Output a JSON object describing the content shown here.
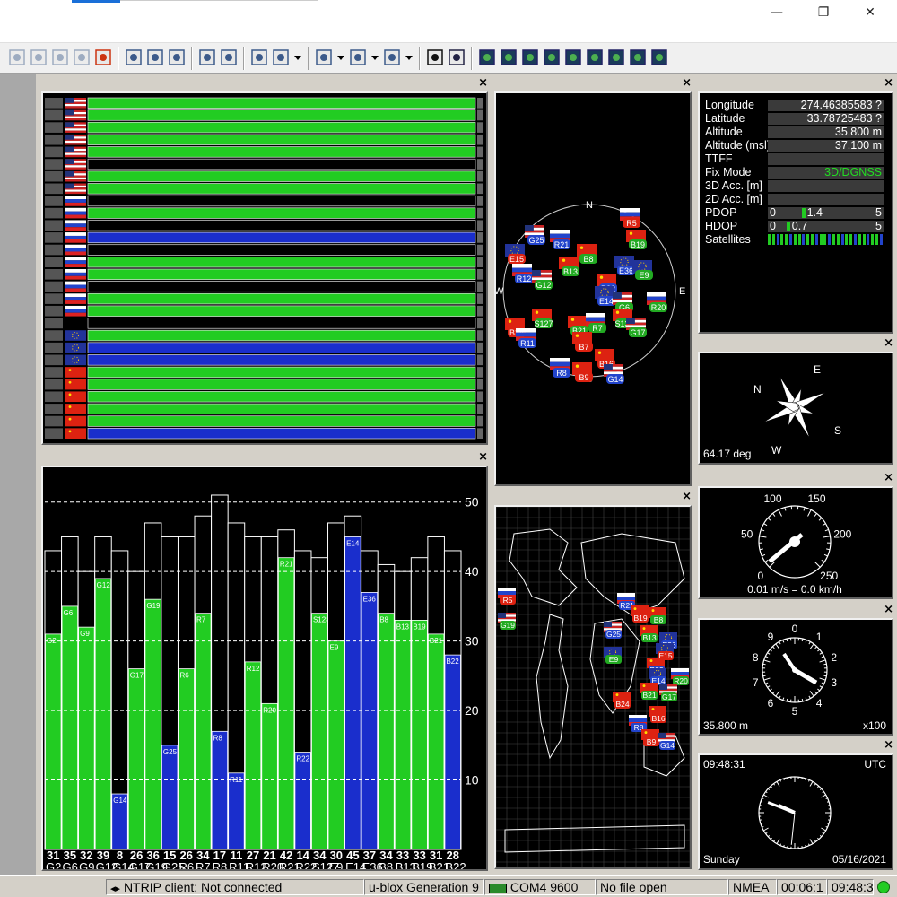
{
  "window": {
    "minimize": "—",
    "restore": "❐",
    "close": "✕",
    "accent": "#1a6fd8"
  },
  "toolbar": {
    "groups": [
      [
        "print-preview-icon",
        "cut-icon",
        "copy-icon",
        "paste-icon",
        "stop-icon"
      ],
      [
        "new-config-icon",
        "load-config-icon",
        "save-config-icon"
      ],
      [
        "view-split-icon",
        "view-panes-icon"
      ],
      [
        "statistics-icon",
        "table-view-icon",
        "dropdown-icon"
      ],
      [
        "chart-a-icon",
        "dropdown-icon",
        "chart-b-icon",
        "dropdown-icon",
        "chart-c-icon",
        "dropdown-icon"
      ],
      [
        "console-icon",
        "target-icon"
      ],
      [
        "sky-view-icon",
        "signal-icon",
        "bar-icon",
        "globe-icon",
        "list-icon",
        "compass-icon",
        "satellite-icon",
        "clock-icon",
        "tools-icon"
      ]
    ]
  },
  "navigation": {
    "rows": [
      {
        "label": "Longitude",
        "value": "274.46385583 ?"
      },
      {
        "label": "Latitude",
        "value": "33.78725483 ?"
      },
      {
        "label": "Altitude",
        "value": "35.800 m"
      },
      {
        "label": "Altitude (msl)",
        "value": "37.100 m"
      },
      {
        "label": "TTFF",
        "value": ""
      },
      {
        "label": "Fix Mode",
        "value": "3D/DGNSS"
      },
      {
        "label": "3D Acc. [m]",
        "value": ""
      },
      {
        "label": "2D Acc. [m]",
        "value": ""
      }
    ],
    "pdop": {
      "label": "PDOP",
      "min": "0",
      "value": "1.4",
      "max": "5",
      "fraction": 0.28
    },
    "hdop": {
      "label": "HDOP",
      "min": "0",
      "value": "0.7",
      "max": "5",
      "fraction": 0.14
    },
    "satellites_label": "Satellites",
    "fix_color": "#22dd22"
  },
  "compass": {
    "heading_text": "64.17 deg",
    "heading": 64.17,
    "n": "N",
    "e": "E",
    "s": "S",
    "w": "W"
  },
  "speedometer": {
    "ticks": [
      "0",
      "50",
      "100",
      "150",
      "200",
      "250"
    ],
    "readout": "0.01 m/s = 0.0 km/h"
  },
  "altimeter": {
    "ticks": [
      "0",
      "1",
      "2",
      "3",
      "4",
      "5",
      "6",
      "7",
      "8",
      "9"
    ],
    "readout": "35.800 m",
    "scale": "x100"
  },
  "clock": {
    "time": "09:48:31",
    "tz": "UTC",
    "day": "Sunday",
    "date": "05/16/2021"
  },
  "skyview": {
    "labels": {
      "n": "N",
      "e": "E",
      "s": "S",
      "w": "W"
    },
    "sats": [
      {
        "id": "G25",
        "flag": "us",
        "c": "#2244cc"
      },
      {
        "id": "R21",
        "flag": "ru",
        "c": "#2244cc"
      },
      {
        "id": "R5",
        "flag": "ru",
        "c": "#dd2211"
      },
      {
        "id": "B19",
        "flag": "cn",
        "c": "#22aa22"
      },
      {
        "id": "B8",
        "flag": "cn",
        "c": "#22aa22"
      },
      {
        "id": "B13",
        "flag": "cn",
        "c": "#22aa22"
      },
      {
        "id": "E36",
        "flag": "eu",
        "c": "#2244cc"
      },
      {
        "id": "E9",
        "flag": "eu",
        "c": "#22aa22"
      },
      {
        "id": "E15",
        "flag": "eu",
        "c": "#dd2211"
      },
      {
        "id": "R12",
        "flag": "ru",
        "c": "#2244cc"
      },
      {
        "id": "G12",
        "flag": "us",
        "c": "#22aa22"
      },
      {
        "id": "B22",
        "flag": "cn",
        "c": "#2244cc"
      },
      {
        "id": "E14",
        "flag": "eu",
        "c": "#2244cc"
      },
      {
        "id": "R20",
        "flag": "ru",
        "c": "#22aa22"
      },
      {
        "id": "G6",
        "flag": "us",
        "c": "#22aa22"
      },
      {
        "id": "S127",
        "flag": "cn",
        "c": "#22aa22"
      },
      {
        "id": "B21",
        "flag": "cn",
        "c": "#22aa22"
      },
      {
        "id": "R7",
        "flag": "ru",
        "c": "#22aa22"
      },
      {
        "id": "S137",
        "flag": "cn",
        "c": "#22aa22"
      },
      {
        "id": "G17",
        "flag": "us",
        "c": "#22aa22"
      },
      {
        "id": "B24",
        "flag": "cn",
        "c": "#dd2211"
      },
      {
        "id": "R11",
        "flag": "ru",
        "c": "#2244cc"
      },
      {
        "id": "B7",
        "flag": "cn",
        "c": "#dd2211"
      },
      {
        "id": "B16",
        "flag": "cn",
        "c": "#dd2211"
      },
      {
        "id": "R8",
        "flag": "ru",
        "c": "#2244cc"
      },
      {
        "id": "B9",
        "flag": "cn",
        "c": "#dd2211"
      },
      {
        "id": "G14",
        "flag": "us",
        "c": "#2244cc"
      }
    ]
  },
  "worldmap": {
    "sats": [
      {
        "id": "R5",
        "flag": "ru",
        "c": "#dd2211"
      },
      {
        "id": "G19",
        "flag": "us",
        "c": "#22aa22"
      },
      {
        "id": "R21",
        "flag": "ru",
        "c": "#2244cc"
      },
      {
        "id": "B19",
        "flag": "cn",
        "c": "#dd2211"
      },
      {
        "id": "B8",
        "flag": "cn",
        "c": "#22aa22"
      },
      {
        "id": "G25",
        "flag": "us",
        "c": "#2244cc"
      },
      {
        "id": "B13",
        "flag": "cn",
        "c": "#22aa22"
      },
      {
        "id": "E36",
        "flag": "eu",
        "c": "#2244cc"
      },
      {
        "id": "E9",
        "flag": "eu",
        "c": "#22aa22"
      },
      {
        "id": "E15",
        "flag": "eu",
        "c": "#dd2211"
      },
      {
        "id": "B22",
        "flag": "cn",
        "c": "#2244cc"
      },
      {
        "id": "E14",
        "flag": "eu",
        "c": "#2244cc"
      },
      {
        "id": "R20",
        "flag": "ru",
        "c": "#22aa22"
      },
      {
        "id": "B21",
        "flag": "cn",
        "c": "#22aa22"
      },
      {
        "id": "G17",
        "flag": "us",
        "c": "#22aa22"
      },
      {
        "id": "B24",
        "flag": "cn",
        "c": "#dd2211"
      },
      {
        "id": "B16",
        "flag": "cn",
        "c": "#dd2211"
      },
      {
        "id": "R8",
        "flag": "ru",
        "c": "#2244cc"
      },
      {
        "id": "B9",
        "flag": "cn",
        "c": "#dd2211"
      },
      {
        "id": "G14",
        "flag": "us",
        "c": "#2244cc"
      }
    ]
  },
  "chart_data": {
    "type": "bar",
    "title": "",
    "ylim": [
      0,
      55
    ],
    "yticks": [
      10,
      20,
      30,
      40,
      50
    ],
    "categories": [
      "G2",
      "G6",
      "G9",
      "G12",
      "G14",
      "G17",
      "G19",
      "G25",
      "R6",
      "R7",
      "R8",
      "R11",
      "R12",
      "R20",
      "R21",
      "R22",
      "S127",
      "E9",
      "E14",
      "E36",
      "B8",
      "B13",
      "B19",
      "B21",
      "B22"
    ],
    "bottom_labels": [
      "G2",
      "G6",
      "G9",
      "G12",
      "G14",
      "G17",
      "G19",
      "G25",
      "R6",
      "R7",
      "R8",
      "R11",
      "R12",
      "R20",
      "R21",
      "R22",
      "S127",
      "E9",
      "E14",
      "E36",
      "B8",
      "B13",
      "B19",
      "B21",
      "B22"
    ],
    "values": [
      31,
      35,
      32,
      39,
      8,
      26,
      36,
      15,
      26,
      34,
      17,
      11,
      27,
      21,
      42,
      14,
      34,
      30,
      45,
      37,
      34,
      33,
      33,
      31,
      28
    ],
    "max_values": [
      43,
      45,
      40,
      45,
      43,
      40,
      47,
      45,
      45,
      48,
      51,
      47,
      45,
      45,
      46,
      43,
      42,
      47,
      48,
      43,
      41,
      40,
      42,
      45,
      43
    ],
    "colors": [
      "g",
      "g",
      "g",
      "g",
      "b",
      "g",
      "g",
      "b",
      "g",
      "g",
      "b",
      "b",
      "g",
      "g",
      "g",
      "b",
      "g",
      "g",
      "b",
      "b",
      "g",
      "g",
      "g",
      "g",
      "b"
    ],
    "bar_labels": [
      "G2",
      "G6",
      "G9",
      "G12",
      "G14",
      "G17",
      "G19",
      "G25",
      "R6",
      "R7",
      "R8",
      "R11",
      "R12",
      "R20",
      "R21",
      "R22",
      "S128",
      "E9",
      "E14",
      "E36",
      "B8",
      "B13",
      "B19",
      "B21",
      "B22"
    ],
    "green": "#22cc22",
    "blue": "#1a2ecc"
  },
  "svlevels": {
    "rows": [
      {
        "flag": "us",
        "segs": [
          "g"
        ]
      },
      {
        "flag": "us",
        "segs": [
          "g"
        ]
      },
      {
        "flag": "us",
        "segs": [
          "g"
        ]
      },
      {
        "flag": "us",
        "segs": [
          "g"
        ]
      },
      {
        "flag": "us",
        "segs": [
          "g"
        ]
      },
      {
        "flag": "us",
        "segs": [
          "d"
        ]
      },
      {
        "flag": "us",
        "segs": [
          "g"
        ]
      },
      {
        "flag": "us",
        "segs": [
          "g"
        ]
      },
      {
        "flag": "ru",
        "segs": [
          "d"
        ]
      },
      {
        "flag": "ru",
        "segs": [
          "g"
        ]
      },
      {
        "flag": "ru",
        "segs": [
          "d"
        ]
      },
      {
        "flag": "ru",
        "segs": [
          "b"
        ]
      },
      {
        "flag": "ru",
        "segs": [
          "d"
        ]
      },
      {
        "flag": "ru",
        "segs": [
          "g"
        ]
      },
      {
        "flag": "ru",
        "segs": [
          "g"
        ]
      },
      {
        "flag": "ru",
        "segs": [
          "d"
        ]
      },
      {
        "flag": "ru",
        "segs": [
          "g"
        ]
      },
      {
        "flag": "ru",
        "segs": [
          "g"
        ]
      },
      {
        "flag": "none",
        "segs": [
          "d"
        ]
      },
      {
        "flag": "eu",
        "segs": [
          "g"
        ]
      },
      {
        "flag": "eu",
        "segs": [
          "b"
        ]
      },
      {
        "flag": "eu",
        "segs": [
          "b"
        ]
      },
      {
        "flag": "cn",
        "segs": [
          "g"
        ]
      },
      {
        "flag": "cn",
        "segs": [
          "g"
        ]
      },
      {
        "flag": "cn",
        "segs": [
          "g"
        ]
      },
      {
        "flag": "cn",
        "segs": [
          "g"
        ]
      },
      {
        "flag": "cn",
        "segs": [
          "g"
        ]
      },
      {
        "flag": "cn",
        "segs": [
          "b"
        ]
      }
    ]
  },
  "status": {
    "ntrip": "NTRIP client: Not connected",
    "receiver": "u-blox Generation 9",
    "port": "COM4 9600",
    "file": "No file open",
    "protocol": "NMEA",
    "elapsed": "00:06:1",
    "time": "09:48:3"
  }
}
